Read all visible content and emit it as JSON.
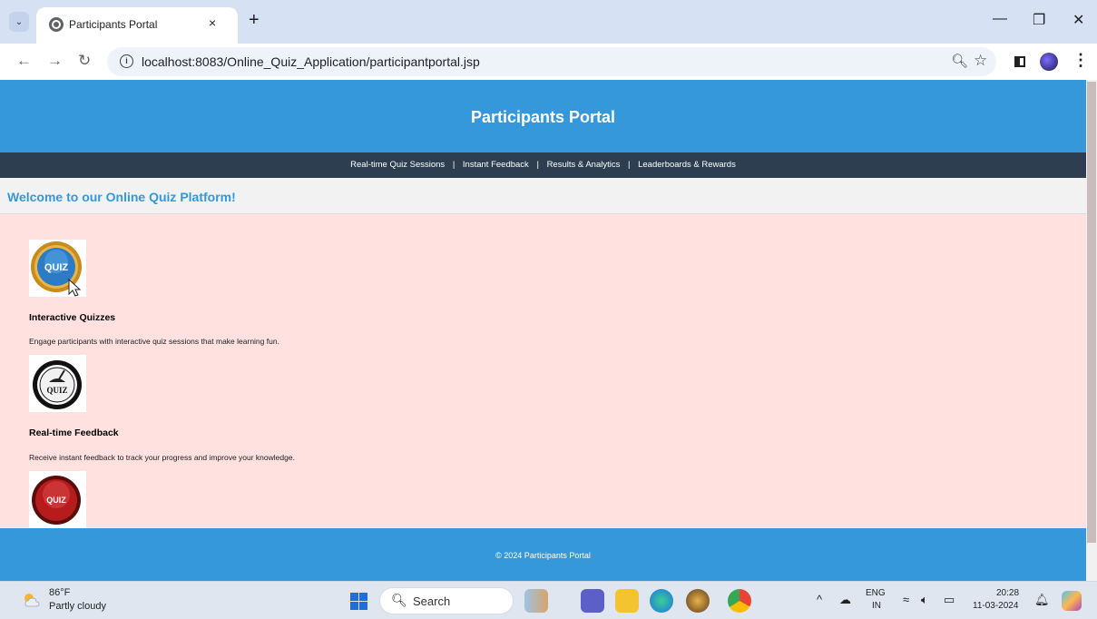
{
  "browser": {
    "tab_title": "Participants Portal",
    "new_tab_glyph": "+",
    "tab_close_glyph": "×",
    "url": "localhost:8083/Online_Quiz_Application/participantportal.jsp",
    "window_controls": {
      "minimize": "—",
      "restore": "❐",
      "close": "✕"
    },
    "nav": {
      "back": "←",
      "forward": "→",
      "reload": "↻"
    }
  },
  "page": {
    "header_title": "Participants Portal",
    "nav_links": [
      {
        "label": "Real-time Quiz Sessions"
      },
      {
        "label": "Instant Feedback"
      },
      {
        "label": "Results & Analytics"
      },
      {
        "label": "Leaderboards & Rewards"
      }
    ],
    "nav_separator": "|",
    "welcome": "Welcome to our Online Quiz Platform!",
    "features": [
      {
        "image_label": "QUIZ",
        "title": "Interactive Quizzes",
        "description": "Engage participants with interactive quiz sessions that make learning fun."
      },
      {
        "image_label": "QUIZ",
        "title": "Real-time Feedback",
        "description": "Receive instant feedback to track your progress and improve your knowledge."
      },
      {
        "image_label": "QUIZ"
      }
    ],
    "footer": "© 2024 Participants Portal"
  },
  "taskbar": {
    "weather_temp": "86°F",
    "weather_condition": "Partly cloudy",
    "search_label": "Search",
    "language_top": "ENG",
    "language_bottom": "IN",
    "time": "20:28",
    "date": "11-03-2024"
  },
  "colors": {
    "header_blue": "#3498db",
    "nav_dark": "#2c3e50",
    "content_bg": "#ffe2df",
    "welcome_bg": "#f2f2f2"
  }
}
